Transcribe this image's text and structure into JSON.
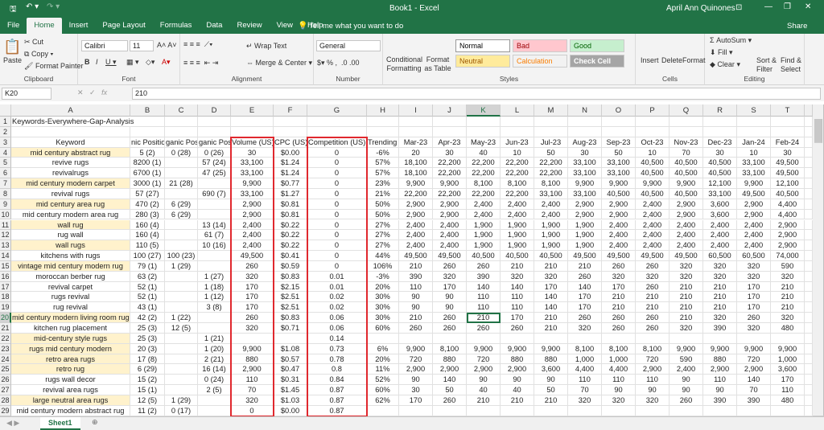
{
  "window": {
    "title": "Book1  -  Excel",
    "user": "April Ann Quinones",
    "share": "Share"
  },
  "tabs": [
    "File",
    "Home",
    "Insert",
    "Page Layout",
    "Formulas",
    "Data",
    "Review",
    "View",
    "Help"
  ],
  "tell_me": "Tell me what you want to do",
  "ribbon": {
    "clipboard": {
      "label": "Clipboard",
      "paste": "Paste",
      "cut": "Cut",
      "copy": "Copy",
      "format_painter": "Format Painter"
    },
    "font": {
      "label": "Font",
      "name": "Calibri",
      "size": "11"
    },
    "alignment": {
      "label": "Alignment",
      "wrap": "Wrap Text",
      "merge": "Merge & Center"
    },
    "number": {
      "label": "Number",
      "format": "General"
    },
    "styles": {
      "label": "Styles",
      "conditional": "Conditional Formatting",
      "format_table": "Format as Table",
      "items": [
        {
          "name": "Normal",
          "bg": "#ffffff",
          "fg": "#000000"
        },
        {
          "name": "Bad",
          "bg": "#ffc7ce",
          "fg": "#9c0006"
        },
        {
          "name": "Good",
          "bg": "#c6efce",
          "fg": "#006100"
        },
        {
          "name": "Neutral",
          "bg": "#ffeb9c",
          "fg": "#9c5700"
        },
        {
          "name": "Calculation",
          "bg": "#f2f2f2",
          "fg": "#fa7d00"
        },
        {
          "name": "Check Cell",
          "bg": "#a5a5a5",
          "fg": "#ffffff"
        }
      ]
    },
    "cells": {
      "label": "Cells",
      "insert": "Insert",
      "delete": "Delete",
      "format": "Format"
    },
    "editing": {
      "label": "Editing",
      "autosum": "AutoSum",
      "fill": "Fill",
      "clear": "Clear",
      "sort": "Sort & Filter",
      "find": "Find & Select"
    }
  },
  "formula_bar": {
    "name_box": "K20",
    "value": "210"
  },
  "columns": [
    "A",
    "B",
    "C",
    "D",
    "E",
    "F",
    "G",
    "H",
    "I",
    "J",
    "K",
    "L",
    "M",
    "N",
    "O",
    "P",
    "Q",
    "R",
    "S",
    "T"
  ],
  "title_cell": "Keywords-Everywhere-Gap-Analysis",
  "headers": [
    "Keyword",
    "nic Positio",
    "ganic Positi",
    "ganic Posit",
    "Volume (US)",
    "CPC (US)",
    "Competition (US)",
    "Trending %",
    "Mar-23",
    "Apr-23",
    "May-23",
    "Jun-23",
    "Jul-23",
    "Aug-23",
    "Sep-23",
    "Oct-23",
    "Nov-23",
    "Dec-23",
    "Jan-24",
    "Feb-24"
  ],
  "highlight_color": "#fff2cc",
  "rows": [
    {
      "h": true,
      "c": [
        "mid century abstract rug",
        "5 (2)",
        "0 (28)",
        "0 (26)",
        "30",
        "$0.00",
        "0",
        "-6%",
        "20",
        "30",
        "40",
        "10",
        "50",
        "30",
        "50",
        "10",
        "70",
        "30",
        "10",
        "30"
      ]
    },
    {
      "h": false,
      "c": [
        "revive rugs",
        "8200 (1)",
        "",
        "57 (24)",
        "33,100",
        "$1.24",
        "0",
        "57%",
        "18,100",
        "22,200",
        "22,200",
        "22,200",
        "22,200",
        "33,100",
        "33,100",
        "40,500",
        "40,500",
        "40,500",
        "33,100",
        "49,500"
      ]
    },
    {
      "h": false,
      "c": [
        "revivalrugs",
        "6700 (1)",
        "",
        "47 (25)",
        "33,100",
        "$1.24",
        "0",
        "57%",
        "18,100",
        "22,200",
        "22,200",
        "22,200",
        "22,200",
        "33,100",
        "33,100",
        "40,500",
        "40,500",
        "40,500",
        "33,100",
        "49,500"
      ]
    },
    {
      "h": true,
      "c": [
        "mid century modern carpet",
        "3000 (1)",
        "21 (28)",
        "",
        "9,900",
        "$0.77",
        "0",
        "23%",
        "9,900",
        "9,900",
        "8,100",
        "8,100",
        "8,100",
        "9,900",
        "9,900",
        "9,900",
        "9,900",
        "12,100",
        "9,900",
        "12,100"
      ]
    },
    {
      "h": false,
      "c": [
        "revival rugs",
        "57 (27)",
        "",
        "690 (7)",
        "33,100",
        "$1.27",
        "0",
        "21%",
        "22,200",
        "22,200",
        "22,200",
        "22,200",
        "33,100",
        "33,100",
        "40,500",
        "40,500",
        "40,500",
        "33,100",
        "49,500",
        "40,500"
      ]
    },
    {
      "h": true,
      "c": [
        "mid century area rug",
        "470 (2)",
        "6 (29)",
        "",
        "2,900",
        "$0.81",
        "0",
        "50%",
        "2,900",
        "2,900",
        "2,400",
        "2,400",
        "2,400",
        "2,900",
        "2,900",
        "2,400",
        "2,900",
        "3,600",
        "2,900",
        "4,400"
      ]
    },
    {
      "h": false,
      "c": [
        "mid century modern area rug",
        "280 (3)",
        "6 (29)",
        "",
        "2,900",
        "$0.81",
        "0",
        "50%",
        "2,900",
        "2,900",
        "2,400",
        "2,400",
        "2,400",
        "2,900",
        "2,900",
        "2,400",
        "2,900",
        "3,600",
        "2,900",
        "4,400"
      ]
    },
    {
      "h": true,
      "c": [
        "wall rug",
        "160 (4)",
        "",
        "13 (14)",
        "2,400",
        "$0.22",
        "0",
        "27%",
        "2,400",
        "2,400",
        "1,900",
        "1,900",
        "1,900",
        "1,900",
        "2,400",
        "2,400",
        "2,400",
        "2,400",
        "2,400",
        "2,900"
      ]
    },
    {
      "h": false,
      "c": [
        "rug wall",
        "160 (4)",
        "",
        "61 (7)",
        "2,400",
        "$0.22",
        "0",
        "27%",
        "2,400",
        "2,400",
        "1,900",
        "1,900",
        "1,900",
        "1,900",
        "2,400",
        "2,400",
        "2,400",
        "2,400",
        "2,400",
        "2,900"
      ]
    },
    {
      "h": true,
      "c": [
        "wall rugs",
        "110 (5)",
        "",
        "10 (16)",
        "2,400",
        "$0.22",
        "0",
        "27%",
        "2,400",
        "2,400",
        "1,900",
        "1,900",
        "1,900",
        "1,900",
        "2,400",
        "2,400",
        "2,400",
        "2,400",
        "2,400",
        "2,900"
      ]
    },
    {
      "h": false,
      "c": [
        "kitchens with rugs",
        "100 (27)",
        "100 (23)",
        "",
        "49,500",
        "$0.41",
        "0",
        "44%",
        "49,500",
        "49,500",
        "40,500",
        "40,500",
        "40,500",
        "49,500",
        "49,500",
        "49,500",
        "49,500",
        "60,500",
        "60,500",
        "74,000"
      ]
    },
    {
      "h": true,
      "c": [
        "vintage mid century modern rug",
        "79 (1)",
        "1 (29)",
        "",
        "260",
        "$0.59",
        "0",
        "106%",
        "210",
        "260",
        "260",
        "210",
        "210",
        "210",
        "260",
        "260",
        "320",
        "320",
        "320",
        "590"
      ]
    },
    {
      "h": false,
      "c": [
        "moroccan berber rug",
        "63 (2)",
        "",
        "1 (27)",
        "320",
        "$0.83",
        "0.01",
        "-3%",
        "390",
        "320",
        "390",
        "320",
        "320",
        "260",
        "320",
        "320",
        "320",
        "320",
        "320",
        "320"
      ]
    },
    {
      "h": false,
      "c": [
        "revival carpet",
        "52 (1)",
        "",
        "1 (18)",
        "170",
        "$2.15",
        "0.01",
        "20%",
        "110",
        "170",
        "140",
        "140",
        "170",
        "140",
        "170",
        "260",
        "210",
        "210",
        "170",
        "210"
      ]
    },
    {
      "h": false,
      "c": [
        "rugs revival",
        "52 (1)",
        "",
        "1 (12)",
        "170",
        "$2.51",
        "0.02",
        "30%",
        "90",
        "90",
        "110",
        "110",
        "140",
        "170",
        "210",
        "210",
        "210",
        "210",
        "170",
        "210"
      ]
    },
    {
      "h": false,
      "c": [
        "rug revival",
        "43 (1)",
        "",
        "3 (8)",
        "170",
        "$2.51",
        "0.02",
        "30%",
        "90",
        "90",
        "110",
        "110",
        "140",
        "170",
        "210",
        "210",
        "210",
        "210",
        "170",
        "210"
      ]
    },
    {
      "h": true,
      "c": [
        "mid century modern living room rug",
        "42 (2)",
        "1 (22)",
        "",
        "260",
        "$0.83",
        "0.06",
        "30%",
        "210",
        "260",
        "210",
        "170",
        "210",
        "260",
        "260",
        "260",
        "210",
        "320",
        "260",
        "320"
      ]
    },
    {
      "h": false,
      "c": [
        "kitchen rug placement",
        "25 (3)",
        "12 (5)",
        "",
        "320",
        "$0.71",
        "0.06",
        "60%",
        "260",
        "260",
        "260",
        "260",
        "210",
        "320",
        "260",
        "260",
        "320",
        "390",
        "320",
        "480"
      ]
    },
    {
      "h": true,
      "c": [
        "mid-century style rugs",
        "25 (3)",
        "",
        "1 (21)",
        "",
        "",
        "0.14",
        "",
        "",
        "",
        "",
        "",
        "",
        "",
        "",
        "",
        "",
        "",
        "",
        ""
      ]
    },
    {
      "h": true,
      "c": [
        "rugs mid century modern",
        "20 (3)",
        "",
        "1 (20)",
        "9,900",
        "$1.08",
        "0.73",
        "6%",
        "9,900",
        "8,100",
        "9,900",
        "9,900",
        "9,900",
        "8,100",
        "8,100",
        "8,100",
        "9,900",
        "9,900",
        "9,900",
        "9,900"
      ]
    },
    {
      "h": true,
      "c": [
        "retro area rugs",
        "17 (8)",
        "",
        "2 (21)",
        "880",
        "$0.57",
        "0.78",
        "20%",
        "720",
        "880",
        "720",
        "880",
        "880",
        "1,000",
        "1,000",
        "720",
        "590",
        "880",
        "720",
        "1,000"
      ]
    },
    {
      "h": true,
      "c": [
        "retro rug",
        "6 (29)",
        "",
        "16 (14)",
        "2,900",
        "$0.47",
        "0.8",
        "11%",
        "2,900",
        "2,900",
        "2,900",
        "2,900",
        "3,600",
        "4,400",
        "4,400",
        "2,900",
        "2,400",
        "2,900",
        "2,900",
        "3,600"
      ]
    },
    {
      "h": false,
      "c": [
        "rugs wall decor",
        "15 (2)",
        "",
        "0 (24)",
        "110",
        "$0.31",
        "0.84",
        "52%",
        "90",
        "140",
        "90",
        "90",
        "90",
        "110",
        "110",
        "110",
        "90",
        "110",
        "140",
        "170"
      ]
    },
    {
      "h": false,
      "c": [
        "revival area rugs",
        "15 (1)",
        "",
        "2 (5)",
        "70",
        "$1.45",
        "0.87",
        "60%",
        "30",
        "50",
        "40",
        "40",
        "50",
        "70",
        "90",
        "90",
        "90",
        "90",
        "70",
        "110"
      ]
    },
    {
      "h": true,
      "c": [
        "large neutral area rugs",
        "12 (5)",
        "1 (29)",
        "",
        "320",
        "$1.03",
        "0.87",
        "62%",
        "170",
        "260",
        "210",
        "210",
        "210",
        "320",
        "320",
        "320",
        "260",
        "390",
        "390",
        "480"
      ]
    },
    {
      "h": false,
      "c": [
        "mid century modern abstract rug",
        "11 (2)",
        "0 (17)",
        "",
        "0",
        "$0.00",
        "0.87",
        "",
        "",
        "",
        "",
        "",
        "",
        "",
        "",
        "",
        "",
        "",
        "",
        ""
      ]
    }
  ],
  "sheets": [
    "Sheet1"
  ],
  "selected_cell": "K20"
}
